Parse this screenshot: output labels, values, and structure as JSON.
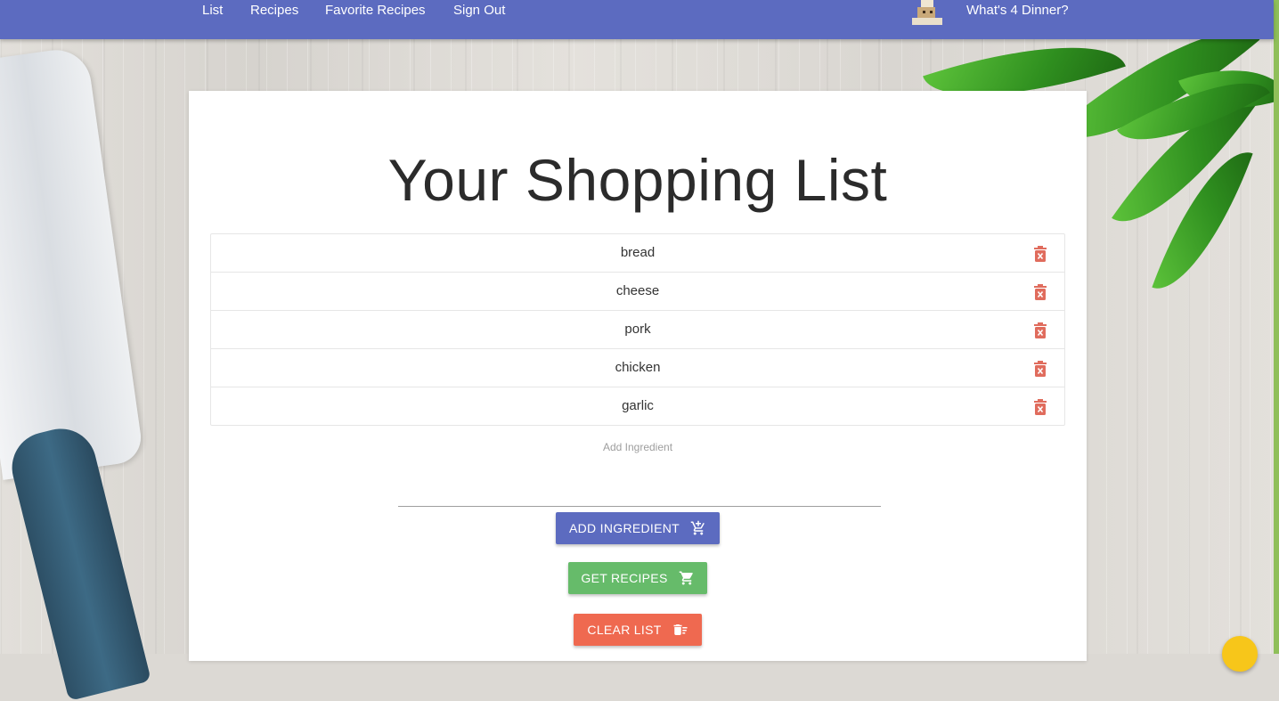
{
  "nav": {
    "links": [
      "List",
      "Recipes",
      "Favorite Recipes",
      "Sign Out"
    ],
    "brand": "What's 4 Dinner?"
  },
  "page": {
    "title": "Your Shopping List",
    "items": [
      "bread",
      "cheese",
      "pork",
      "chicken",
      "garlic"
    ],
    "input_label": "Add Ingredient",
    "input_value": ""
  },
  "buttons": {
    "add": "ADD INGREDIENT",
    "get": "GET RECIPES",
    "clear": "CLEAR LIST"
  },
  "colors": {
    "header": "#5c6bc0",
    "add_button": "#5c6bc0",
    "get_button": "#66bb6a",
    "clear_button": "#ef6950",
    "delete_icon": "#e06c5d"
  },
  "icons": {
    "add": "add-shopping-cart-icon",
    "get": "shopping-cart-icon",
    "clear": "clear-list-icon",
    "delete": "delete-forever-icon"
  }
}
